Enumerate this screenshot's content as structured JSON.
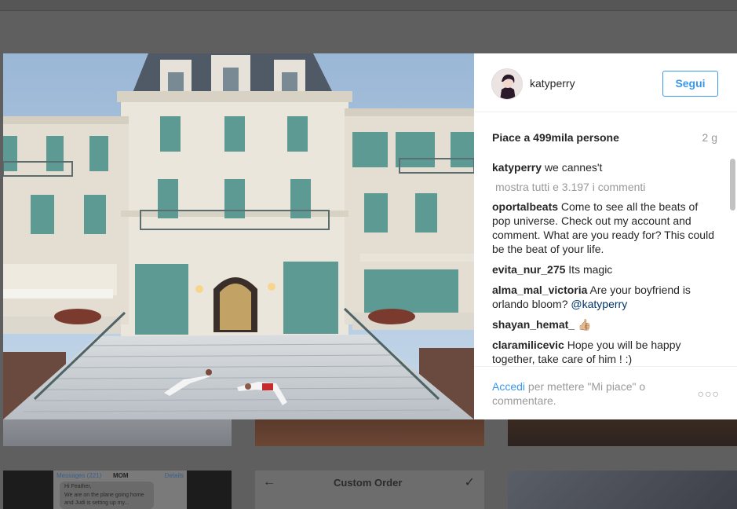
{
  "backdrop": {
    "messages": {
      "back_label": "Messages (221)",
      "contact": "MOM",
      "details_label": "Details",
      "lines": [
        "Hi Feather,",
        "We are on the plane going home",
        "and Judi is setting up my..."
      ]
    },
    "custom_order": {
      "title": "Custom Order"
    }
  },
  "post": {
    "username": "katyperry",
    "follow_label": "Segui",
    "likes": "Piace a 499mila persone",
    "time": "2 g",
    "caption": {
      "user": "katyperry",
      "text": "we cannes't"
    },
    "show_all_comments": "mostra tutti e 3.197 i commenti",
    "comments": [
      {
        "user": "oportalbeats",
        "text": "Come to see all the beats of pop universe. Check out my account and comment. What are you ready for? This could be the beat of your life."
      },
      {
        "user": "evita_nur_275",
        "text": "Its magic"
      },
      {
        "user": "alma_mal_victoria",
        "text": "Are your boyfriend is orlando bloom?",
        "mention": "@katyperry"
      },
      {
        "user": "shayan_hemat_",
        "text": "👍🏼"
      },
      {
        "user": "claramilicevic",
        "text": "Hope you will be happy together, take care of him ! :)"
      }
    ],
    "login_link": "Accedi",
    "login_text": "per mettere \"Mi piace\" o commentare.",
    "more_icon": "more-options-icon"
  },
  "colors": {
    "accent": "#3897f0",
    "text": "#262626",
    "muted": "#999999",
    "mention": "#003569"
  }
}
